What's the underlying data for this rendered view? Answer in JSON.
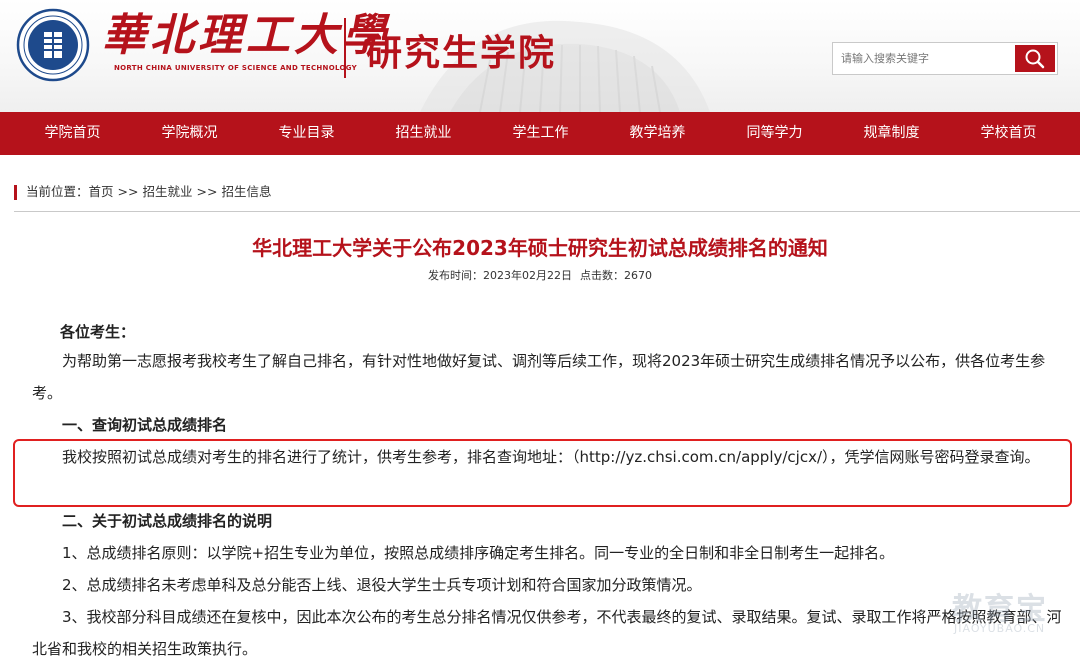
{
  "header": {
    "school_name_cn": "華北理工大學",
    "school_name_en": "NORTH CHINA UNIVERSITY OF SCIENCE AND TECHNOLOGY",
    "department": "研究生学院",
    "brand_color": "#b5121b"
  },
  "search": {
    "placeholder": "请输入搜索关键字",
    "button_icon": "search-icon"
  },
  "nav": {
    "items": [
      {
        "label": "学院首页"
      },
      {
        "label": "学院概况"
      },
      {
        "label": "专业目录"
      },
      {
        "label": "招生就业"
      },
      {
        "label": "学生工作"
      },
      {
        "label": "教学培养"
      },
      {
        "label": "同等学力"
      },
      {
        "label": "规章制度"
      },
      {
        "label": "学校首页"
      }
    ]
  },
  "breadcrumb": {
    "prefix": "当前位置：",
    "items": [
      "首页",
      "招生就业",
      "招生信息"
    ],
    "separator": ">>"
  },
  "article": {
    "title": "华北理工大学关于公布2023年硕士研究生初试总成绩排名的通知",
    "publish_time": "发布时间：2023年02月22日",
    "clicks": "点击数：2670",
    "greeting": "各位考生：",
    "p1": "为帮助第一志愿报考我校考生了解自己排名，有针对性地做好复试、调剂等后续工作，现将2023年硕士研究生成绩排名情况予以公布，供各位考生参考。",
    "h1": "一、查询初试总成绩排名",
    "p2": "我校按照初试总成绩对考生的排名进行了统计，供考生参考，排名查询地址：（http://yz.chsi.com.cn/apply/cjcx/），凭学信网账号密码登录查询。",
    "h2": "二、关于初试总成绩排名的说明",
    "p3": "1、总成绩排名原则：以学院+招生专业为单位，按照总成绩排序确定考生排名。同一专业的全日制和非全日制考生一起排名。",
    "p4": "2、总成绩排名未考虑单科及总分能否上线、退役大学生士兵专项计划和符合国家加分政策情况。",
    "p5": "3、我校部分科目成绩还在复核中，因此本次公布的考生总分排名情况仅供参考，不代表最终的复试、录取结果。复试、录取工作将严格按照教育部、河北省和我校的相关招生政策执行。"
  },
  "watermark": {
    "cn": "教育宝",
    "en": "JIAOYUBAO.CN"
  }
}
